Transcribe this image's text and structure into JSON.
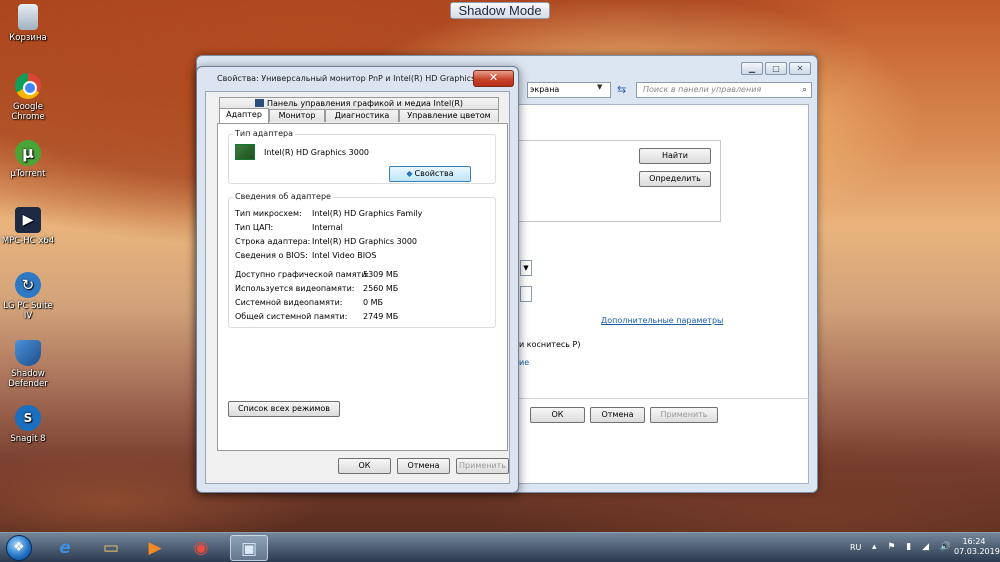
{
  "banner": {
    "label": "Shadow Mode"
  },
  "desktop": {
    "icons": [
      {
        "label": "Корзина",
        "icon": "recycle-bin-icon"
      },
      {
        "label": "Google Chrome",
        "icon": "chrome-icon"
      },
      {
        "label": "µTorrent",
        "icon": "utorrent-icon"
      },
      {
        "label": "MPC-HC x64",
        "icon": "mpc-hc-icon"
      },
      {
        "label": "LG PC Suite IV",
        "icon": "lg-pc-suite-icon"
      },
      {
        "label": "Shadow Defender",
        "icon": "shadow-defender-icon"
      },
      {
        "label": "Snagit 8",
        "icon": "snagit-icon"
      }
    ]
  },
  "background_window": {
    "address_text": "экрана",
    "search_placeholder": "Поиск в панели управления",
    "find_button": "Найти",
    "detect_button": "Определить",
    "advanced_link": "Дополнительные параметры",
    "partial_text": "и коснитесь Р)",
    "partial_link": "ие",
    "ok_button": "ОК",
    "cancel_button": "Отмена",
    "apply_button": "Применить"
  },
  "dialog": {
    "title": "Свойства: Универсальный монитор PnP и Intel(R) HD Graphics 3000",
    "tabs_top": [
      "Панель управления графикой и медиа Intel(R)"
    ],
    "tabs": [
      "Адаптер",
      "Монитор",
      "Диагностика",
      "Управление цветом"
    ],
    "active_tab": "Адаптер",
    "adapter_type": {
      "group_label": "Тип адаптера",
      "name": "Intel(R) HD Graphics 3000",
      "properties_button": "Свойства"
    },
    "adapter_info": {
      "group_label": "Сведения об адаптере",
      "rows": [
        {
          "label": "Тип микросхем:",
          "value": "Intel(R) HD Graphics Family"
        },
        {
          "label": "Тип ЦАП:",
          "value": "Internal"
        },
        {
          "label": "Строка адаптера:",
          "value": "Intel(R) HD Graphics 3000"
        },
        {
          "label": "Сведения о BIOS:",
          "value": "Intel Video BIOS"
        }
      ],
      "memory_rows": [
        {
          "label": "Доступно графической памяти:",
          "value": "5309 МБ"
        },
        {
          "label": "Используется видеопамяти:",
          "value": "2560 МБ"
        },
        {
          "label": "Системной видеопамяти:",
          "value": "0 МБ"
        },
        {
          "label": "Общей системной памяти:",
          "value": "2749 МБ"
        }
      ]
    },
    "list_modes_button": "Список всех режимов",
    "ok_button": "ОК",
    "cancel_button": "Отмена",
    "apply_button": "Применить",
    "close_glyph": "✕"
  },
  "taskbar": {
    "apps": [
      {
        "name": "internet-explorer",
        "icon": "e"
      },
      {
        "name": "file-explorer",
        "icon": "▭"
      },
      {
        "name": "media-player",
        "icon": "▶"
      },
      {
        "name": "chrome",
        "icon": "◉"
      },
      {
        "name": "control-panel",
        "icon": "▣"
      }
    ],
    "language": "RU",
    "tray_icons": "▴ ⚑ ▮ ◢ 🔊",
    "time": "16:24",
    "date": "07.03.2019"
  }
}
